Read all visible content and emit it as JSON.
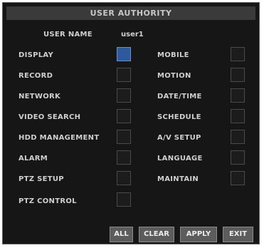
{
  "dialog": {
    "title": "USER AUTHORITY",
    "user_name_label": "USER NAME",
    "user_name_value": "user1"
  },
  "permissions": {
    "left": [
      {
        "label": "DISPLAY",
        "checked": true
      },
      {
        "label": "RECORD",
        "checked": false
      },
      {
        "label": "NETWORK",
        "checked": false
      },
      {
        "label": "VIDEO SEARCH",
        "checked": false
      },
      {
        "label": "HDD MANAGEMENT",
        "checked": false
      },
      {
        "label": "ALARM",
        "checked": false
      },
      {
        "label": "PTZ SETUP",
        "checked": false
      },
      {
        "label": "PTZ CONTROL",
        "checked": false
      }
    ],
    "right": [
      {
        "label": "MOBILE",
        "checked": false
      },
      {
        "label": "MOTION",
        "checked": false
      },
      {
        "label": "DATE/TIME",
        "checked": false
      },
      {
        "label": "SCHEDULE",
        "checked": false
      },
      {
        "label": "A/V SETUP",
        "checked": false
      },
      {
        "label": "LANGUAGE",
        "checked": false
      },
      {
        "label": "MAINTAIN",
        "checked": false
      }
    ]
  },
  "buttons": {
    "all": "ALL",
    "clear": "CLEAR",
    "apply": "APPLY",
    "exit": "EXIT"
  },
  "colors": {
    "background": "#161616",
    "checked": "#2c5a9a",
    "button": "#5c5c5c"
  }
}
